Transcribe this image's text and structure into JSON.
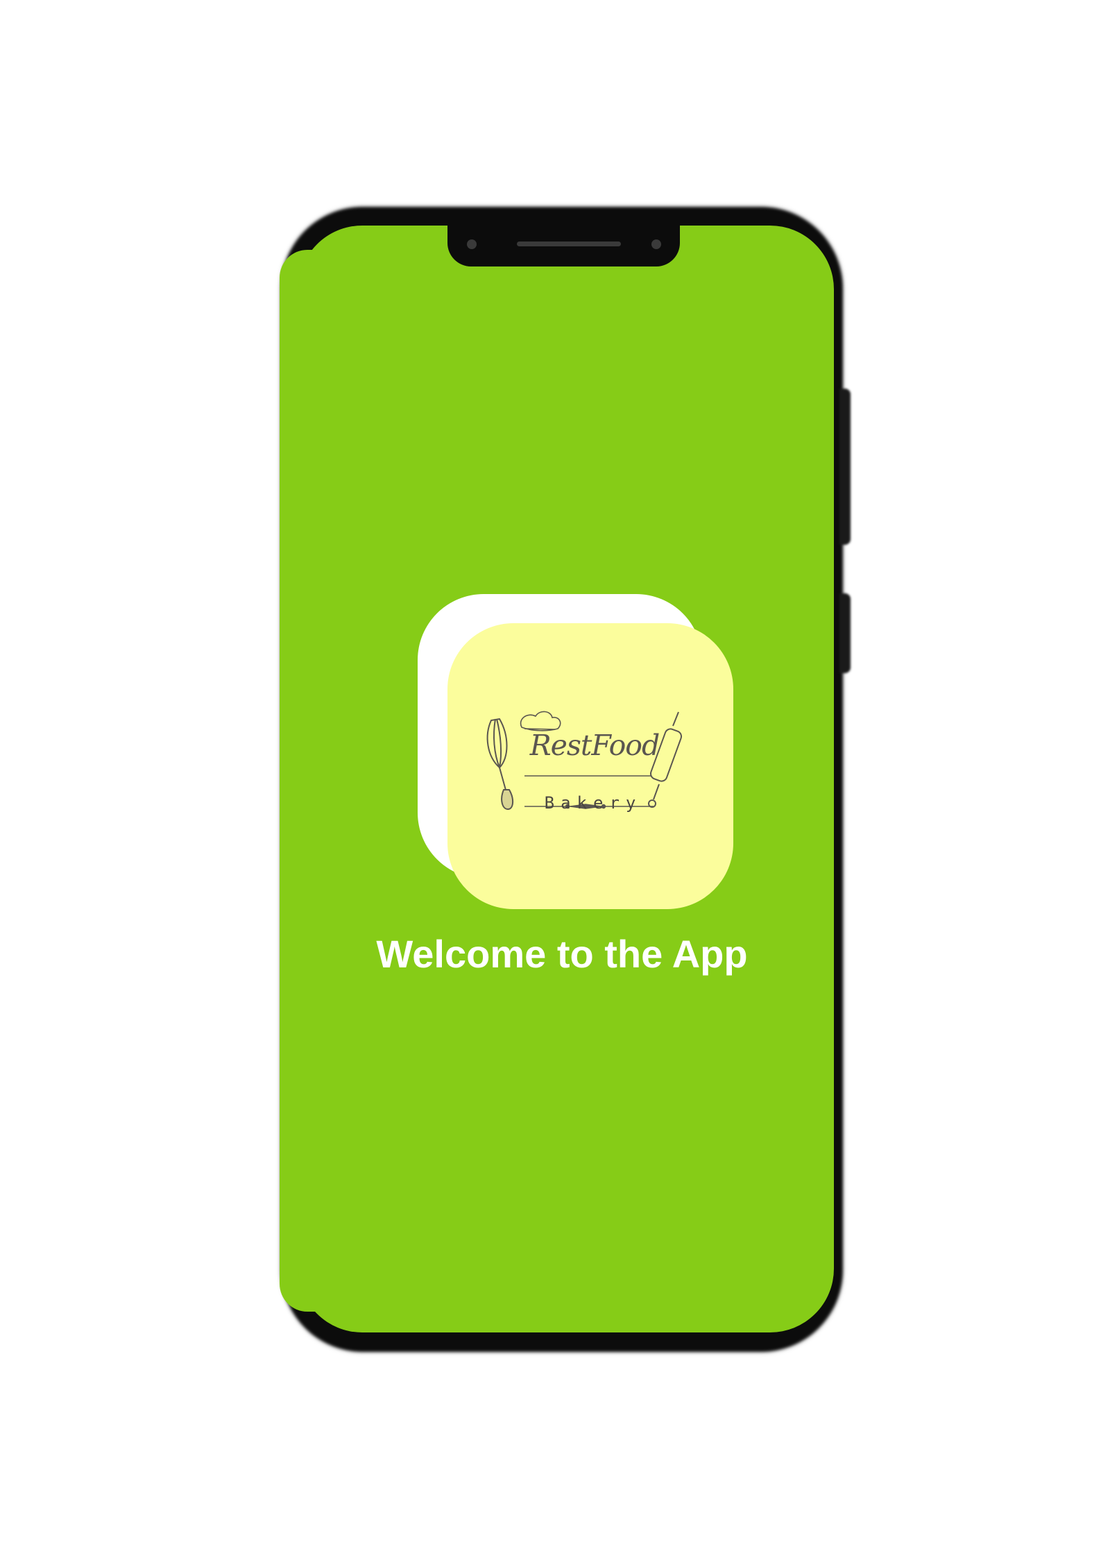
{
  "screen": {
    "background_color": "#86cc17"
  },
  "logo": {
    "title": "RestFood",
    "subtitle": "Bakery",
    "tile_color": "#fbfd9c",
    "icons": [
      "whisk-icon",
      "rolling-pin-icon",
      "chef-hat-icon"
    ]
  },
  "welcome": {
    "text": "Welcome to the App"
  }
}
